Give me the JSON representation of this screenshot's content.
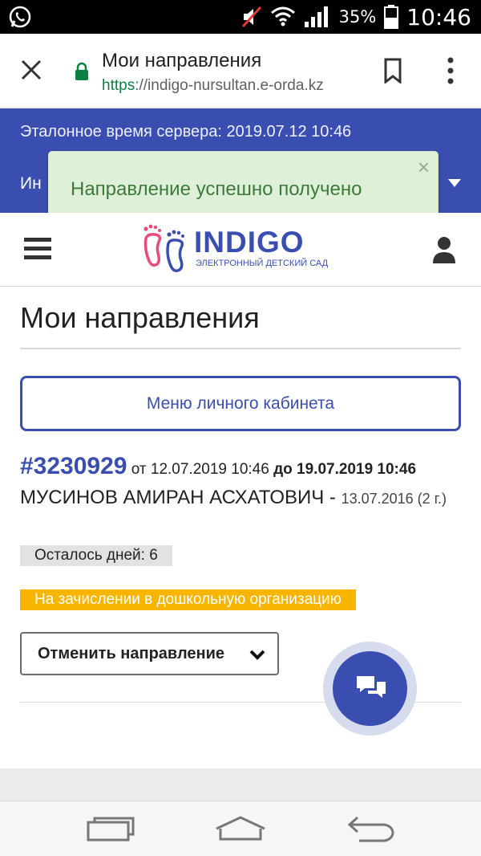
{
  "status_bar": {
    "battery_pct": "35%",
    "time": "10:46",
    "icons": [
      "whatsapp-icon",
      "mute-icon",
      "wifi-icon",
      "signal-icon",
      "battery-icon"
    ]
  },
  "browser": {
    "title": "Мои направления",
    "url_scheme": "https",
    "url_rest": "://indigo-nursultan.e-orda.kz",
    "icons": [
      "close-icon",
      "lock-icon",
      "bookmark-icon",
      "more-vert-icon"
    ]
  },
  "blue_band": {
    "server_time": "Эталонное время сервера: 2019.07.12 10:46",
    "lang_label_partial": "Ин"
  },
  "toast": {
    "message": "Направление успешно получено",
    "close": "×"
  },
  "header": {
    "logo_word": "INDIGO",
    "logo_sub": "ЭЛЕКТРОННЫЙ ДЕТСКИЙ САД"
  },
  "main": {
    "page_title": "Мои направления",
    "cabinet_button": "Меню личного кабинета",
    "referral": {
      "number": "#3230929",
      "from": " от 12.07.2019 10:46 ",
      "to": "до 19.07.2019 10:46",
      "child_name": "МУСИНОВ АМИРАН АСХАТОВИЧ - ",
      "child_dob": "13.07.2016 (2 г.)",
      "days_left": "Осталось дней: 6",
      "status": "На зачислении в дошкольную организацию",
      "cancel_button": "Отменить направление"
    }
  },
  "colors": {
    "brand_blue": "#3a4db0",
    "toast_bg": "#dff0d8",
    "toast_text": "#3c7a3c",
    "status_orange": "#f7b500"
  }
}
